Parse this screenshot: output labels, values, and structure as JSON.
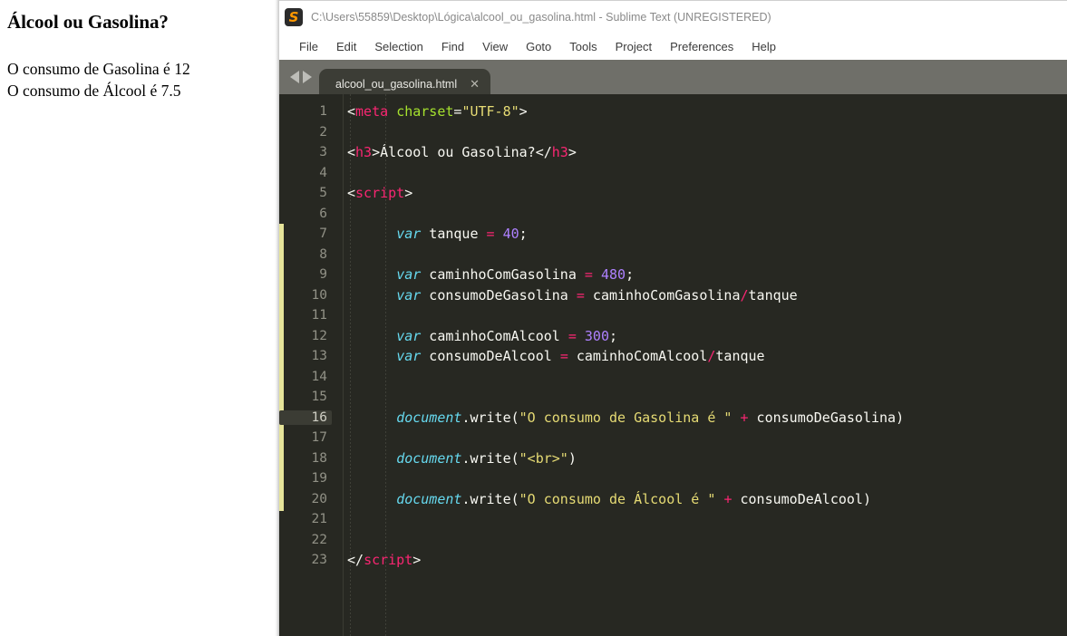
{
  "browser": {
    "heading": "Álcool ou Gasolina?",
    "output_lines": [
      "O consumo de Gasolina é 12",
      "O consumo de Álcool é 7.5"
    ]
  },
  "sublime": {
    "icon": "sublime-text-icon",
    "icon_glyph": "S",
    "title": "C:\\Users\\55859\\Desktop\\Lógica\\alcool_ou_gasolina.html - Sublime Text (UNREGISTERED)",
    "menu": [
      "File",
      "Edit",
      "Selection",
      "Find",
      "View",
      "Goto",
      "Tools",
      "Project",
      "Preferences",
      "Help"
    ],
    "tabs": [
      {
        "label": "alcool_ou_gasolina.html",
        "close_glyph": "✕",
        "active": true
      }
    ],
    "nav": {
      "back_icon": "arrow-left-icon",
      "forward_icon": "arrow-right-icon"
    },
    "active_line": 16,
    "colors": {
      "background": "#272822",
      "foreground": "#f8f8f2",
      "tag": "#f92672",
      "attribute": "#a6e22e",
      "string": "#e6db74",
      "keyword": "#66d9ef",
      "number": "#ae81ff",
      "operator": "#f92672",
      "gutter_text": "#919186",
      "fold_marker": "#e6e49a",
      "tab_bar": "#6f6f69",
      "tab_active": "#3c3d36",
      "title_text": "#8a8a8a"
    },
    "code": [
      {
        "n": 1,
        "tokens": [
          {
            "t": "punc",
            "v": "<"
          },
          {
            "t": "tag",
            "v": "meta"
          },
          {
            "t": "plain",
            "v": " "
          },
          {
            "t": "attr",
            "v": "charset"
          },
          {
            "t": "punc",
            "v": "="
          },
          {
            "t": "string",
            "v": "\"UTF-8\""
          },
          {
            "t": "punc",
            "v": ">"
          }
        ]
      },
      {
        "n": 2,
        "tokens": []
      },
      {
        "n": 3,
        "tokens": [
          {
            "t": "punc",
            "v": "<"
          },
          {
            "t": "tag",
            "v": "h3"
          },
          {
            "t": "punc",
            "v": ">"
          },
          {
            "t": "plain",
            "v": "Álcool ou Gasolina?"
          },
          {
            "t": "punc",
            "v": "</"
          },
          {
            "t": "tag",
            "v": "h3"
          },
          {
            "t": "punc",
            "v": ">"
          }
        ]
      },
      {
        "n": 4,
        "tokens": []
      },
      {
        "n": 5,
        "tokens": [
          {
            "t": "punc",
            "v": "<"
          },
          {
            "t": "tag",
            "v": "script"
          },
          {
            "t": "punc",
            "v": ">"
          }
        ]
      },
      {
        "n": 6,
        "tokens": []
      },
      {
        "n": 7,
        "tokens": [
          {
            "t": "plain",
            "v": "      "
          },
          {
            "t": "kw",
            "v": "var"
          },
          {
            "t": "plain",
            "v": " tanque "
          },
          {
            "t": "op",
            "v": "="
          },
          {
            "t": "plain",
            "v": " "
          },
          {
            "t": "num",
            "v": "40"
          },
          {
            "t": "plain",
            "v": ";"
          }
        ]
      },
      {
        "n": 8,
        "tokens": []
      },
      {
        "n": 9,
        "tokens": [
          {
            "t": "plain",
            "v": "      "
          },
          {
            "t": "kw",
            "v": "var"
          },
          {
            "t": "plain",
            "v": " caminhoComGasolina "
          },
          {
            "t": "op",
            "v": "="
          },
          {
            "t": "plain",
            "v": " "
          },
          {
            "t": "num",
            "v": "480"
          },
          {
            "t": "plain",
            "v": ";"
          }
        ]
      },
      {
        "n": 10,
        "tokens": [
          {
            "t": "plain",
            "v": "      "
          },
          {
            "t": "kw",
            "v": "var"
          },
          {
            "t": "plain",
            "v": " consumoDeGasolina "
          },
          {
            "t": "op",
            "v": "="
          },
          {
            "t": "plain",
            "v": " caminhoComGasolina"
          },
          {
            "t": "op",
            "v": "/"
          },
          {
            "t": "plain",
            "v": "tanque"
          }
        ]
      },
      {
        "n": 11,
        "tokens": []
      },
      {
        "n": 12,
        "tokens": [
          {
            "t": "plain",
            "v": "      "
          },
          {
            "t": "kw",
            "v": "var"
          },
          {
            "t": "plain",
            "v": " caminhoComAlcool "
          },
          {
            "t": "op",
            "v": "="
          },
          {
            "t": "plain",
            "v": " "
          },
          {
            "t": "num",
            "v": "300"
          },
          {
            "t": "plain",
            "v": ";"
          }
        ]
      },
      {
        "n": 13,
        "tokens": [
          {
            "t": "plain",
            "v": "      "
          },
          {
            "t": "kw",
            "v": "var"
          },
          {
            "t": "plain",
            "v": " consumoDeAlcool "
          },
          {
            "t": "op",
            "v": "="
          },
          {
            "t": "plain",
            "v": " caminhoComAlcool"
          },
          {
            "t": "op",
            "v": "/"
          },
          {
            "t": "plain",
            "v": "tanque"
          }
        ]
      },
      {
        "n": 14,
        "tokens": []
      },
      {
        "n": 15,
        "tokens": []
      },
      {
        "n": 16,
        "tokens": [
          {
            "t": "plain",
            "v": "      "
          },
          {
            "t": "obj",
            "v": "document"
          },
          {
            "t": "plain",
            "v": ".write("
          },
          {
            "t": "string",
            "v": "\"O consumo de Gasolina é \""
          },
          {
            "t": "plain",
            "v": " "
          },
          {
            "t": "op",
            "v": "+"
          },
          {
            "t": "plain",
            "v": " consumoDeGasolina)"
          }
        ]
      },
      {
        "n": 17,
        "tokens": []
      },
      {
        "n": 18,
        "tokens": [
          {
            "t": "plain",
            "v": "      "
          },
          {
            "t": "obj",
            "v": "document"
          },
          {
            "t": "plain",
            "v": ".write("
          },
          {
            "t": "string",
            "v": "\"<br>\""
          },
          {
            "t": "plain",
            "v": ")"
          }
        ]
      },
      {
        "n": 19,
        "tokens": []
      },
      {
        "n": 20,
        "tokens": [
          {
            "t": "plain",
            "v": "      "
          },
          {
            "t": "obj",
            "v": "document"
          },
          {
            "t": "plain",
            "v": ".write("
          },
          {
            "t": "string",
            "v": "\"O consumo de Álcool é \""
          },
          {
            "t": "plain",
            "v": " "
          },
          {
            "t": "op",
            "v": "+"
          },
          {
            "t": "plain",
            "v": " consumoDeAlcool)"
          }
        ]
      },
      {
        "n": 21,
        "tokens": []
      },
      {
        "n": 22,
        "tokens": []
      },
      {
        "n": 23,
        "tokens": [
          {
            "t": "punc",
            "v": "</"
          },
          {
            "t": "tag",
            "v": "script"
          },
          {
            "t": "punc",
            "v": ">"
          }
        ]
      }
    ]
  }
}
